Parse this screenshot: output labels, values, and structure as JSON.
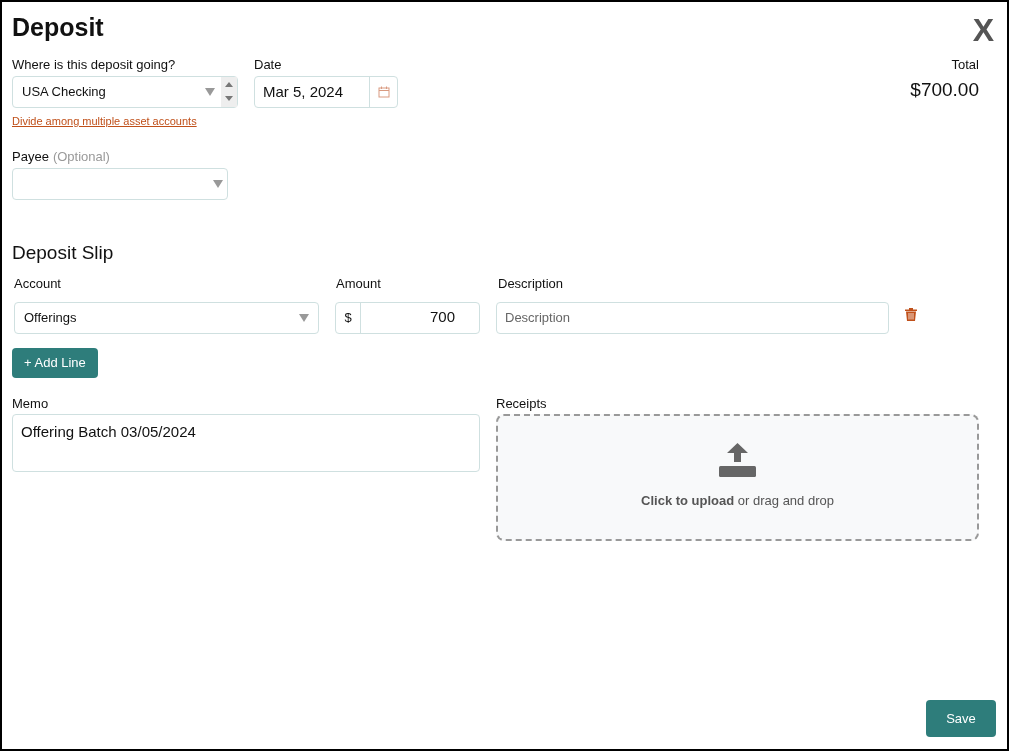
{
  "window": {
    "title": "Deposit",
    "close": "X"
  },
  "destination": {
    "label": "Where is this deposit going?",
    "value": "USA Checking",
    "link": "Divide among multiple asset accounts"
  },
  "date": {
    "label": "Date",
    "value": "Mar 5, 2024"
  },
  "total": {
    "label": "Total",
    "value": "$700.00"
  },
  "payee": {
    "label": "Payee",
    "hint": "(Optional)"
  },
  "deposit_slip": {
    "title": "Deposit Slip",
    "columns": [
      "Account",
      "Amount",
      "Description"
    ],
    "lines": [
      {
        "account": "Offerings",
        "currency": "$",
        "amount": "700",
        "description_placeholder": "Description"
      }
    ],
    "add_button": "+ Add Line"
  },
  "memo": {
    "label": "Memo",
    "value": "Offering Batch 03/05/2024"
  },
  "receipts": {
    "label": "Receipts",
    "text": "**Click to upload** or drag and drop"
  },
  "buttons": [
    "Save"
  ]
}
